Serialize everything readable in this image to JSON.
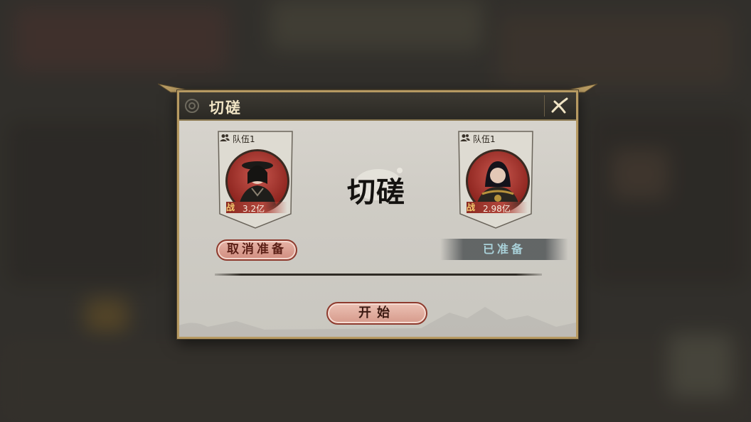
{
  "dialog": {
    "title": "切磋",
    "center_title": "切磋",
    "close_icon": "close-brush-x-icon"
  },
  "teams": [
    {
      "label": "队伍1",
      "power_tag": "战",
      "power": "3.2亿",
      "icon": "team-members-icon"
    },
    {
      "label": "队伍1",
      "power_tag": "战",
      "power": "2.98亿",
      "icon": "team-members-icon"
    }
  ],
  "actions": {
    "cancel_ready": "取消准备",
    "ready_status": "已准备",
    "start": "开始"
  },
  "colors": {
    "header_bg": "#2b2924",
    "frame_gold": "#b79a62",
    "button_red": "#d18e80",
    "ready_text": "#a9d1d9"
  }
}
